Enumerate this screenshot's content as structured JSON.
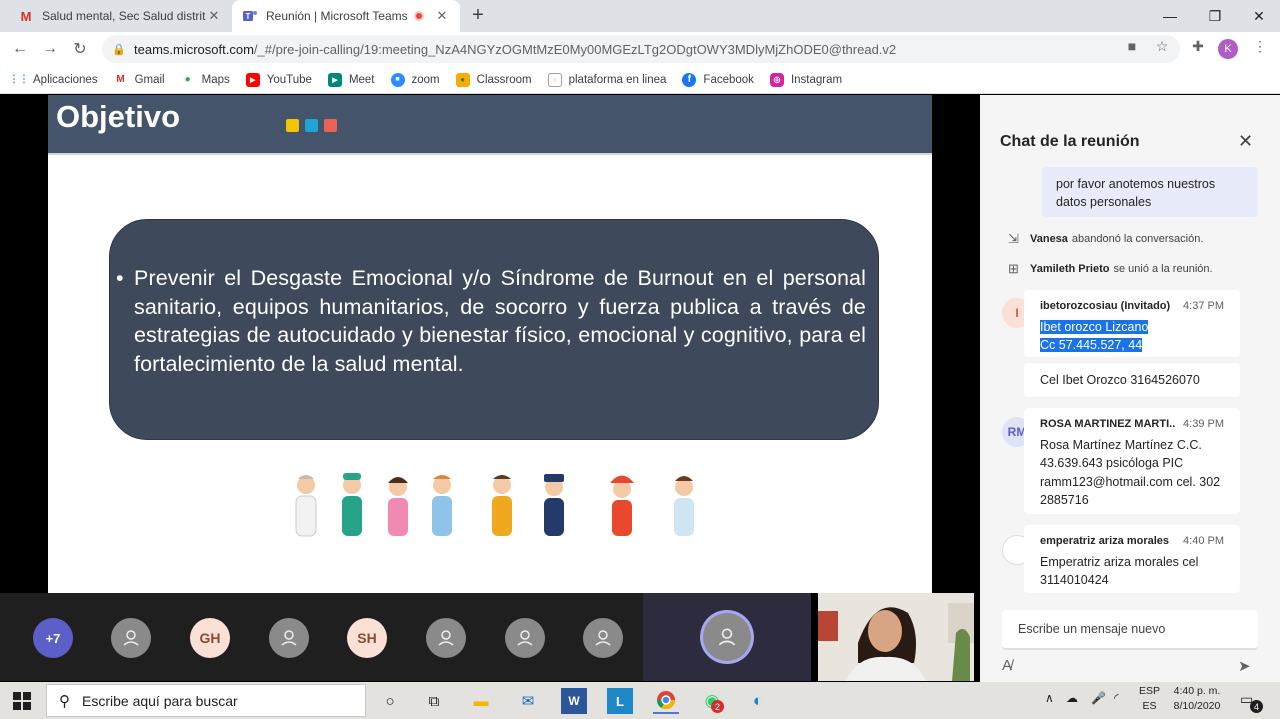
{
  "browser": {
    "tabs": [
      {
        "title": "Salud mental, Sec Salud distrital ·"
      },
      {
        "title": "Reunión | Microsoft Teams"
      }
    ],
    "url_host": "teams.microsoft.com",
    "url_path": "/_#/pre-join-calling/19:meeting_NzA4NGYzOGMtMzE0My00MGEzLTg2ODgtOWY3MDlyMjZhODE0@thread.v2",
    "profile_initial": "K",
    "bookmarks": [
      "Aplicaciones",
      "Gmail",
      "Maps",
      "YouTube",
      "Meet",
      "zoom",
      "Classroom",
      "plataforma en linea",
      "Facebook",
      "Instagram"
    ]
  },
  "slide": {
    "title": "Objetivo",
    "square_colors": [
      "#f5c400",
      "#1ea5d6",
      "#e8625a"
    ],
    "bullet": "Prevenir el Desgaste Emocional y/o Síndrome de Burnout en el personal sanitario, equipos humanitarios, de socorro y fuerza publica a través de estrategias de autocuidado y bienestar físico, emocional y cognitivo, para el fortalecimiento de la salud mental."
  },
  "participants": {
    "more": "+7",
    "tiles": [
      "",
      "GH",
      "",
      "SH",
      "",
      "",
      ""
    ]
  },
  "chat": {
    "title": "Chat de la reunión",
    "own_message": "por favor anotemos nuestros datos personales",
    "events": [
      {
        "name": "Vanesa",
        "text": "abandonó la conversación."
      },
      {
        "name": "Yamileth Prieto",
        "text": "se unió a la reunión."
      }
    ],
    "messages": [
      {
        "initials": "I",
        "sender": "ibetorozcosiau (Invitado)",
        "time": "4:37 PM",
        "line1": "Ibet orozco Lizcano",
        "line2": "Cc 57.445.527, 44"
      },
      {
        "text": "Cel Ibet Orozco 3164526070"
      },
      {
        "initials": "RM",
        "sender": "ROSA MARTINEZ MARTI...",
        "time": "4:39 PM",
        "text": "Rosa Martínez Martínez C.C. 43.639.643 psicóloga PIC ramm123@hotmail.com cel. 302 2885716"
      },
      {
        "sender": "emperatriz ariza morales",
        "time": "4:40 PM",
        "text": "Emperatriz ariza morales cel 3114010424"
      }
    ],
    "compose_placeholder": "Escribe un mensaje nuevo"
  },
  "taskbar": {
    "search_placeholder": "Escribe aquí para buscar",
    "lang_top": "ESP",
    "lang_bottom": "ES",
    "time": "4:40 p. m.",
    "date": "8/10/2020",
    "whatsapp_badge": "2",
    "notif_badge": "4"
  }
}
